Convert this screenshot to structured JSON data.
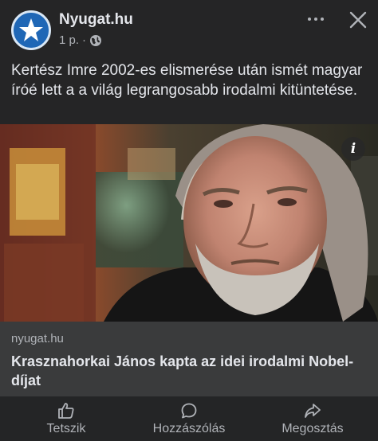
{
  "header": {
    "page_name": "Nyugat.hu",
    "time": "1 p.",
    "separator": "·",
    "icons": {
      "avatar": "star-logo",
      "audience": "globe-icon",
      "more": "more-icon",
      "close": "close-icon"
    }
  },
  "post": {
    "caption": "Kertész Imre 2002-es elismerése után ismét magyar íróé lett a a világ legrangosabb irodalmi kitüntetése."
  },
  "link": {
    "info_glyph": "i",
    "domain": "nyugat.hu",
    "title": "Krasznahorkai János kapta az idei irodalmi Nobel-díjat"
  },
  "actions": [
    {
      "label": "Tetszik",
      "icon": "thumbs-up-icon"
    },
    {
      "label": "Hozzászólás",
      "icon": "comment-icon"
    },
    {
      "label": "Megosztás",
      "icon": "share-icon"
    }
  ],
  "colors": {
    "background": "#252526",
    "link_card": "#3a3b3c",
    "primary_text": "#e4e6eb",
    "secondary_text": "#b0b3b8",
    "avatar_blue": "#1f67b6"
  }
}
